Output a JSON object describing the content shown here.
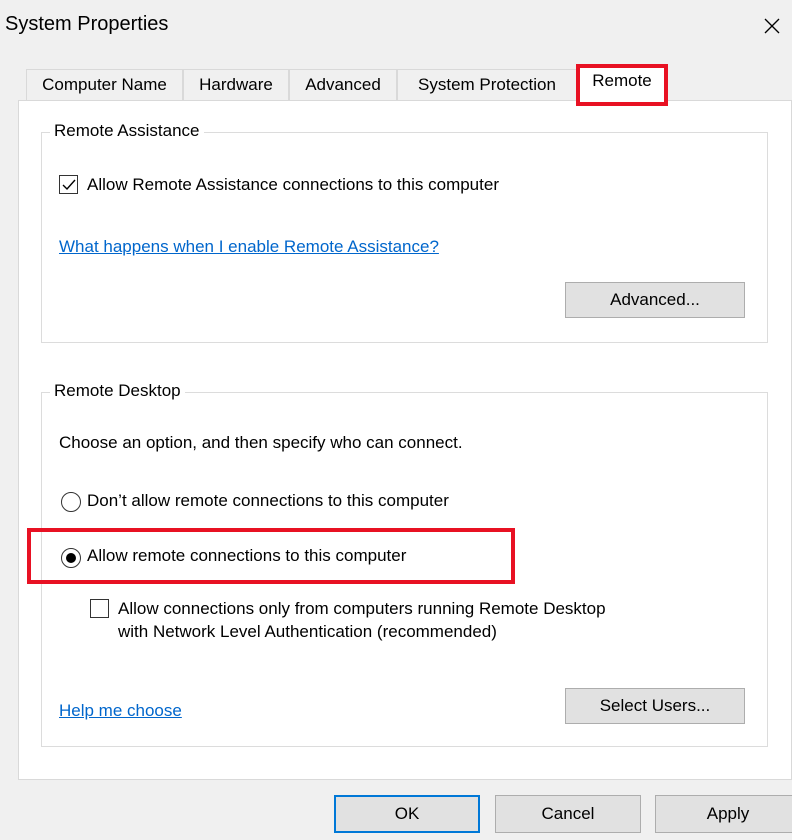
{
  "window": {
    "title": "System Properties",
    "close_icon": "close-icon"
  },
  "tabs": [
    {
      "label": "Computer Name",
      "selected": false
    },
    {
      "label": "Hardware",
      "selected": false
    },
    {
      "label": "Advanced",
      "selected": false
    },
    {
      "label": "System Protection",
      "selected": false
    },
    {
      "label": "Remote",
      "selected": true
    }
  ],
  "remote_assistance": {
    "legend": "Remote Assistance",
    "allow_checkbox": {
      "label": "Allow Remote Assistance connections to this computer",
      "checked": true
    },
    "help_link": "What happens when I enable Remote Assistance?",
    "advanced_button": "Advanced..."
  },
  "remote_desktop": {
    "legend": "Remote Desktop",
    "instruction": "Choose an option, and then specify who can connect.",
    "options": [
      {
        "label": "Don’t allow remote connections to this computer",
        "selected": false
      },
      {
        "label": "Allow remote connections to this computer",
        "selected": true
      }
    ],
    "nla_checkbox": {
      "line1": "Allow connections only from computers running Remote Desktop",
      "line2": "with Network Level Authentication (recommended)",
      "checked": false
    },
    "help_link": "Help me choose",
    "select_users_button": "Select Users..."
  },
  "footer": {
    "ok": "OK",
    "cancel": "Cancel",
    "apply": "Apply"
  },
  "colors": {
    "highlight": "#e81123",
    "link": "#0066cc",
    "default_button_border": "#0078d7"
  }
}
